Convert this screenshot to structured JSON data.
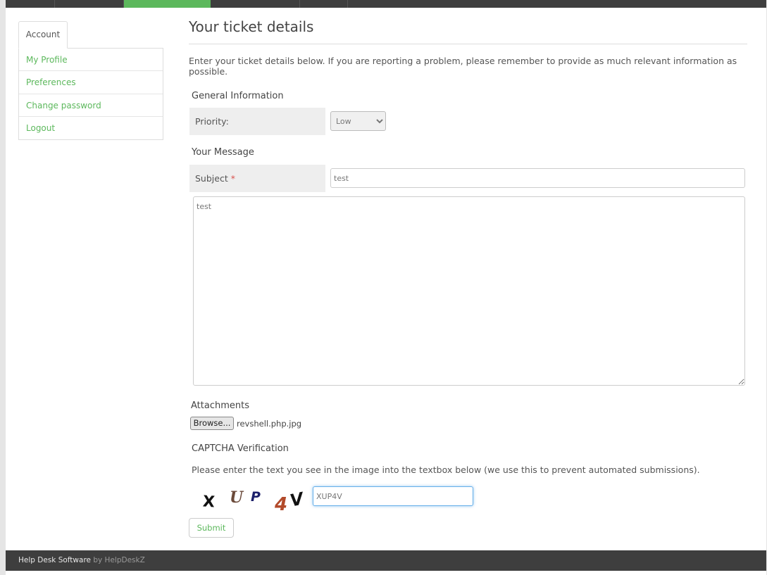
{
  "sidebar": {
    "tab_label": "Account",
    "items": [
      {
        "label": "My Profile"
      },
      {
        "label": "Preferences"
      },
      {
        "label": "Change password"
      },
      {
        "label": "Logout"
      }
    ]
  },
  "main": {
    "title": "Your ticket details",
    "intro": "Enter your ticket details below. If you are reporting a problem, please remember to provide as much relevant information as possible.",
    "general_info": {
      "heading": "General Information",
      "priority_label": "Priority:",
      "priority_value": "Low"
    },
    "message": {
      "heading": "Your Message",
      "subject_label": "Subject",
      "required_mark": "*",
      "subject_value": "test",
      "body_value": "test"
    },
    "attachments": {
      "heading": "Attachments",
      "browse_label": "Browse...",
      "file_name": "revshell.php.jpg"
    },
    "captcha": {
      "heading": "CAPTCHA Verification",
      "instructions": "Please enter the text you see in the image into the textbox below (we use this to prevent automated submissions).",
      "image_text": "XUP4V",
      "input_value": "XUP4V"
    },
    "submit_label": "Submit"
  },
  "footer": {
    "link_text": "Help Desk Software",
    "by_text": " by HelpDeskZ"
  },
  "colors": {
    "accent": "#5cb85c",
    "nav_bg": "#3e3e3e",
    "required": "#d9534f"
  }
}
